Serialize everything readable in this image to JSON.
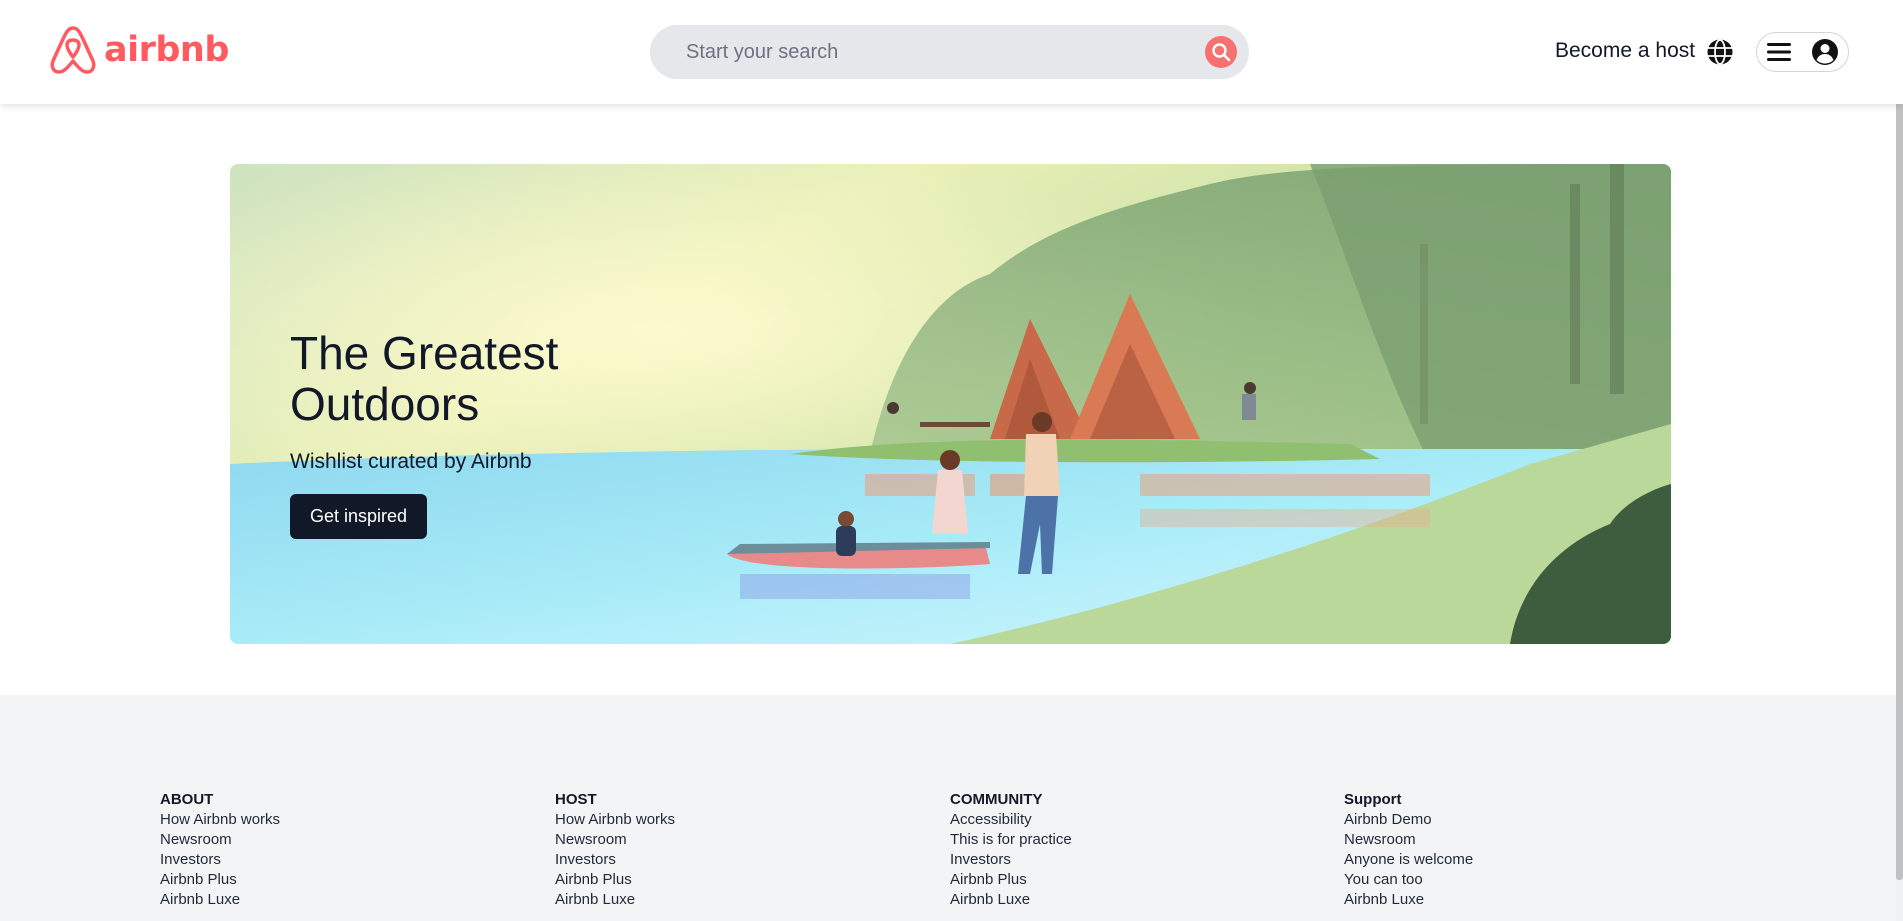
{
  "header": {
    "logo_text": "airbnb",
    "search_placeholder": "Start your search",
    "become_host": "Become a host",
    "brand_color": "#ff5a5f"
  },
  "hero": {
    "title": "The Greatest Outdoors",
    "subtitle": "Wishlist curated by Airbnb",
    "button": "Get inspired"
  },
  "footer": {
    "columns": [
      {
        "heading": "ABOUT",
        "links": [
          "How Airbnb works",
          "Newsroom",
          "Investors",
          "Airbnb Plus",
          "Airbnb Luxe"
        ]
      },
      {
        "heading": "HOST",
        "links": [
          "How Airbnb works",
          "Newsroom",
          "Investors",
          "Airbnb Plus",
          "Airbnb Luxe"
        ]
      },
      {
        "heading": "COMMUNITY",
        "links": [
          "Accessibility",
          "This is for practice",
          "Investors",
          "Airbnb Plus",
          "Airbnb Luxe"
        ]
      },
      {
        "heading": "Support",
        "links": [
          "Airbnb Demo",
          "Newsroom",
          "Anyone is welcome",
          "You can too",
          "Airbnb Luxe"
        ]
      }
    ]
  },
  "icons": {
    "logo": "airbnb-belo-icon",
    "search": "search-icon",
    "globe": "globe-icon",
    "menu": "hamburger-menu-icon",
    "user": "user-avatar-icon"
  }
}
